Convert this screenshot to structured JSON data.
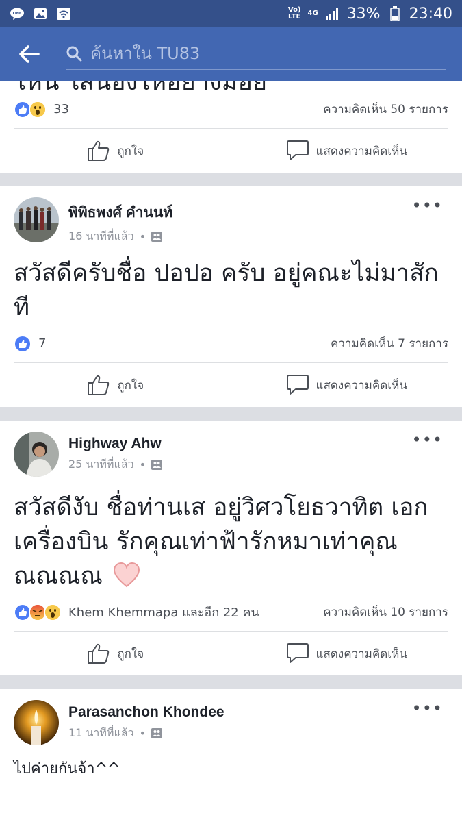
{
  "status_bar": {
    "left_icons": [
      "line-icon",
      "image-icon",
      "wifi-icon"
    ],
    "volte": "Vo)\nLTE",
    "network": "4G",
    "battery": "33%",
    "time": "23:40"
  },
  "search": {
    "placeholder": "ค้นหาใน TU83"
  },
  "colors": {
    "header_bg": "#4267b2",
    "statusbar_bg": "#34508a",
    "like_blue": "#4c7cf6",
    "separator": "#dcdee3"
  },
  "posts": [
    {
      "cut_text": "ไหน ใส่น้องไหอย่างมือย",
      "reaction_icons": [
        "like",
        "wow"
      ],
      "reaction_count": "33",
      "comments": "ความคิดเห็น 50 รายการ",
      "like_label": "ถูกใจ",
      "comment_label": "แสดงความคิดเห็น"
    },
    {
      "author": "พิพิธพงศ์ คำนนท์",
      "time": "16 นาทีที่แล้ว",
      "body": "สวัสดีครับชื่อ ปอปอ ครับ อยู่คณะไม่มาสักที",
      "reaction_icons": [
        "like"
      ],
      "reaction_count": "7",
      "comments": "ความคิดเห็น 7 รายการ",
      "like_label": "ถูกใจ",
      "comment_label": "แสดงความคิดเห็น"
    },
    {
      "author": "Highway Ahw",
      "time": "25 นาทีที่แล้ว",
      "body": "สวัสดีงับ ชื่อท่านเส อยู่วิศวโยธวาทิต เอกเครื่องบิน รักคุณเท่าฟ้ารักหมาเท่าคุณ ณณณณ",
      "reaction_icons": [
        "like",
        "angry",
        "wow"
      ],
      "reaction_count": "Khem Khemmapa และอีก 22 คน",
      "comments": "ความคิดเห็น 10 รายการ",
      "like_label": "ถูกใจ",
      "comment_label": "แสดงความคิดเห็น"
    },
    {
      "author": "Parasanchon Khondee",
      "time": "11 นาทีที่แล้ว",
      "body": "ไปค่ายกันจ้า^^"
    }
  ],
  "more_label": "•••"
}
